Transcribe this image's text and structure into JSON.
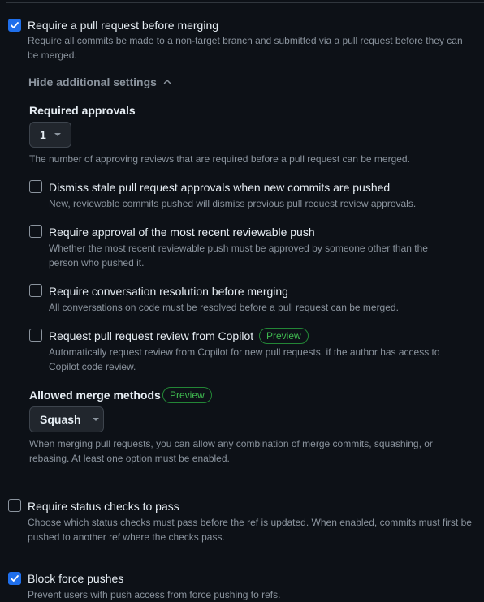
{
  "pull_request": {
    "checked": true,
    "title": "Require a pull request before merging",
    "desc_line1": "Require all commits be made to a non-target branch and submitted via a pull request before they can",
    "desc_line2": "be merged.",
    "toggle_label": "Hide additional settings",
    "approvals": {
      "label": "Required approvals",
      "value": "1",
      "desc": "The number of approving reviews that are required before a pull request can be merged."
    },
    "options": [
      {
        "checked": false,
        "title": "Dismiss stale pull request approvals when new commits are pushed",
        "desc_line1": "New, reviewable commits pushed will dismiss previous pull request review approvals.",
        "desc_line2": ""
      },
      {
        "checked": false,
        "title": "Require approval of the most recent reviewable push",
        "desc_line1": "Whether the most recent reviewable push must be approved by someone other than the",
        "desc_line2": "person who pushed it."
      },
      {
        "checked": false,
        "title": "Require conversation resolution before merging",
        "desc_line1": "All conversations on code must be resolved before a pull request can be merged.",
        "desc_line2": ""
      },
      {
        "checked": false,
        "title": "Request pull request review from Copilot",
        "badge": "Preview",
        "desc_line1": "Automatically request review from Copilot for new pull requests, if the author has access to",
        "desc_line2": "Copilot code review."
      }
    ],
    "merge_methods": {
      "label": "Allowed merge methods",
      "badge": "Preview",
      "value": "Squash",
      "desc_line1": "When merging pull requests, you can allow any combination of merge commits, squashing, or",
      "desc_line2": "rebasing. At least one option must be enabled."
    }
  },
  "status_checks": {
    "checked": false,
    "title": "Require status checks to pass",
    "desc_line1": "Choose which status checks must pass before the ref is updated. When enabled, commits must first be",
    "desc_line2": "pushed to another ref where the checks pass."
  },
  "force_push": {
    "checked": true,
    "title": "Block force pushes",
    "desc_line1": "Prevent users with push access from force pushing to refs."
  },
  "colors": {
    "background": "#0d1117",
    "checkbox_checked": "#1f6feb",
    "badge": "#3fb950",
    "muted_text": "#8b949e"
  }
}
